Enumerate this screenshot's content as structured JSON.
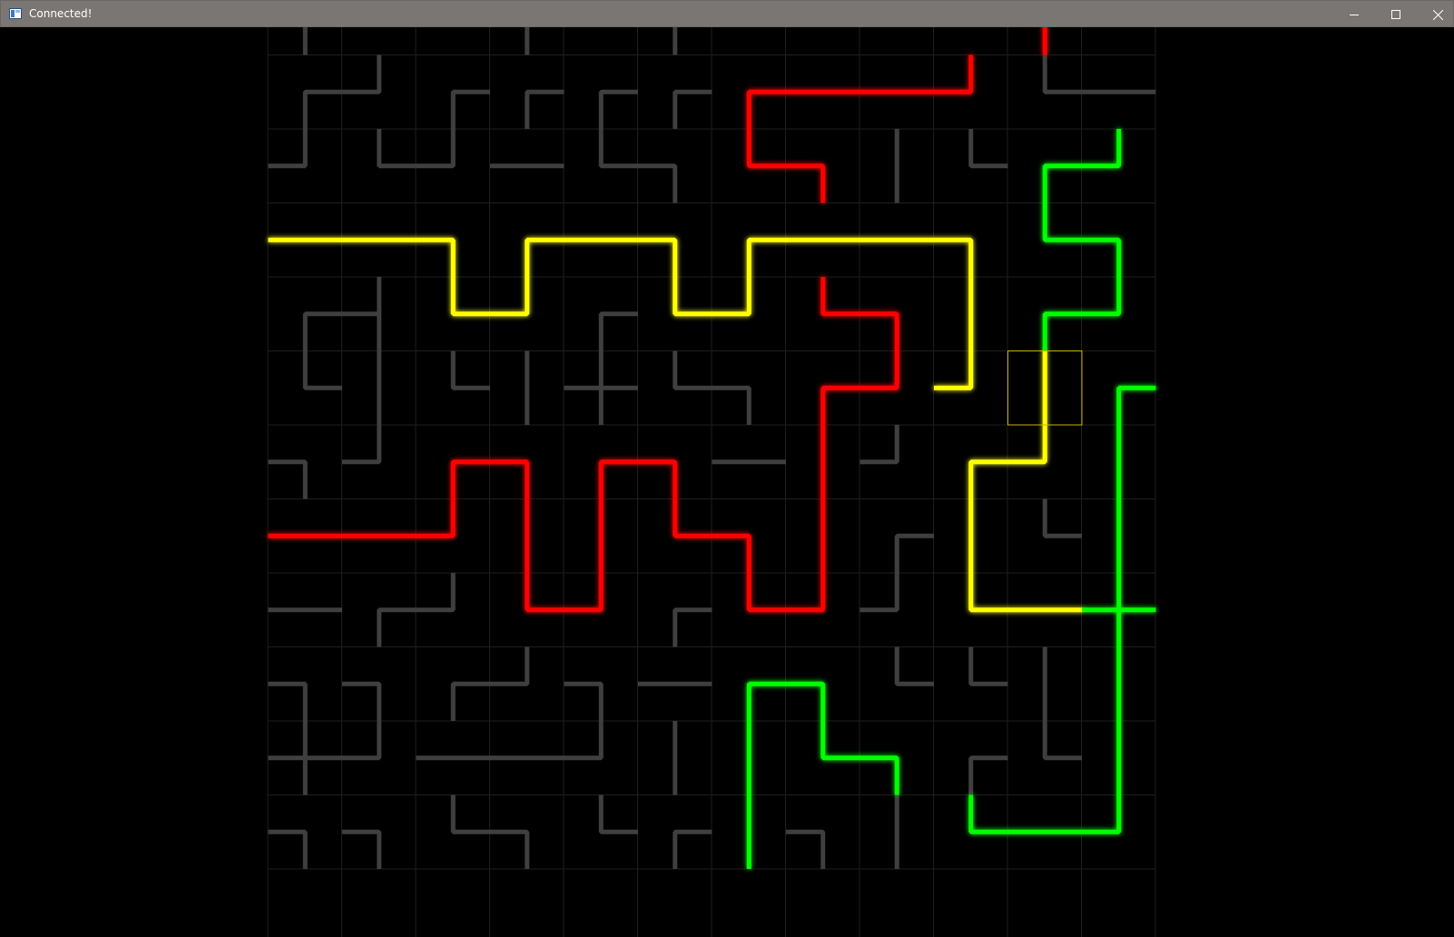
{
  "window": {
    "title": "Connected!",
    "controls": {
      "minimize": "minimize-icon",
      "maximize": "maximize-icon",
      "close": "close-icon"
    }
  },
  "game": {
    "cols": 12,
    "rows": 12,
    "colors": {
      "background": "#000000",
      "grid": "#1e1e1e",
      "inactive": "#3f3f3f",
      "red": "#ff0000",
      "yellow": "#ffff00",
      "green": "#00ff00",
      "cursor": "#c8b400"
    },
    "cursor": {
      "col": 10,
      "row": 5
    },
    "tiles": [
      [
        "gray",
        "e",
        "nse"
      ],
      [
        "gray",
        "w",
        "nw"
      ],
      [
        "gray",
        "e",
        "n"
      ],
      [
        "gray",
        "e",
        "es"
      ],
      [
        "gray",
        "e",
        "ew"
      ],
      [
        "gray",
        "e",
        "esw"
      ],
      [
        "gray",
        "e",
        "ew"
      ],
      [
        "gray",
        "e",
        "ew"
      ],
      [
        "gray",
        "e",
        "w"
      ],
      [
        "gray",
        "e",
        "en"
      ],
      [
        "red",
        "e",
        "es"
      ],
      [
        "red",
        "e",
        "ew"
      ],
      [
        "gray",
        "e",
        "es"
      ],
      [
        "gray",
        "e",
        "nw"
      ],
      [
        "gray",
        "e",
        "es"
      ],
      [
        "gray",
        "e",
        "es"
      ],
      [
        "gray",
        "e",
        "es"
      ],
      [
        "gray",
        "e",
        "es"
      ],
      [
        "red",
        "e",
        "es"
      ],
      [
        "red",
        "e",
        "ew"
      ],
      [
        "red",
        "e",
        "ew"
      ],
      [
        "red",
        "e",
        "nw"
      ],
      [
        "gray",
        "e",
        "ne"
      ],
      [
        "gray",
        "e",
        "ew"
      ],
      [
        "gray",
        "e",
        "nw"
      ],
      [
        "gray",
        "e",
        "ne"
      ],
      [
        "gray",
        "e",
        "nw"
      ],
      [
        "gray",
        "e",
        "ew"
      ],
      [
        "gray",
        "e",
        "ne"
      ],
      [
        "gray",
        "e",
        "sw"
      ],
      [
        "red",
        "e",
        "ne"
      ],
      [
        "red",
        "e",
        "sw"
      ],
      [
        "gray",
        "e",
        "ns"
      ],
      [
        "gray",
        "e",
        "ne"
      ],
      [
        "green",
        "e",
        "es"
      ],
      [
        "green",
        "e",
        "nw"
      ],
      [
        "yellow",
        "e",
        "ew"
      ],
      [
        "yellow",
        "e",
        "ew"
      ],
      [
        "yellow",
        "e",
        "sw"
      ],
      [
        "yellow",
        "e",
        "es"
      ],
      [
        "yellow",
        "e",
        "ew"
      ],
      [
        "yellow",
        "e",
        "sw"
      ],
      [
        "yellow",
        "e",
        "es"
      ],
      [
        "yellow",
        "e",
        "ew"
      ],
      [
        "yellow",
        "e",
        "ew"
      ],
      [
        "yellow",
        "e",
        "sw"
      ],
      [
        "green",
        "e",
        "ne"
      ],
      [
        "green",
        "e",
        "sw"
      ],
      [
        "gray",
        "e",
        "es"
      ],
      [
        "gray",
        "e",
        "nsw"
      ],
      [
        "yellow",
        "e",
        "ne"
      ],
      [
        "yellow",
        "e",
        "nw"
      ],
      [
        "gray",
        "e",
        "es"
      ],
      [
        "yellow",
        "e",
        "ne"
      ],
      [
        "yellow",
        "e",
        "nw"
      ],
      [
        "red",
        "e",
        "ne"
      ],
      [
        "red",
        "e",
        "sw"
      ],
      [
        "yellow",
        "e",
        "ns"
      ],
      [
        "green",
        "e",
        "es"
      ],
      [
        "green",
        "e",
        "nw"
      ],
      [
        "gray",
        "e",
        "ne"
      ],
      [
        "gray",
        "e",
        "ns"
      ],
      [
        "gray",
        "e",
        "ne"
      ],
      [
        "gray",
        "e",
        "ns"
      ],
      [
        "gray",
        "e",
        "nsew"
      ],
      [
        "gray",
        "e",
        "ne"
      ],
      [
        "gray",
        "e",
        "sw"
      ],
      [
        "red",
        "e",
        "es"
      ],
      [
        "red",
        "e",
        "nw"
      ],
      [
        "yellow",
        "e",
        "nw"
      ],
      [
        "yellow",
        "e",
        "ns"
      ],
      [
        "green",
        "e",
        "es"
      ],
      [
        "gray",
        "e",
        "sw"
      ],
      [
        "gray",
        "e",
        "nw"
      ],
      [
        "red",
        "e",
        "es"
      ],
      [
        "red",
        "e",
        "sw"
      ],
      [
        "red",
        "e",
        "es"
      ],
      [
        "red",
        "e",
        "sw"
      ],
      [
        "gray",
        "e",
        "ew"
      ],
      [
        "red",
        "e",
        "ns"
      ],
      [
        "gray",
        "e",
        "nw"
      ],
      [
        "yellow",
        "e",
        "es"
      ],
      [
        "yellow",
        "e",
        "nw"
      ],
      [
        "green",
        "e",
        "ns"
      ],
      [
        "red",
        "e",
        "ew"
      ],
      [
        "red",
        "e",
        "ew"
      ],
      [
        "red",
        "e",
        "nw"
      ],
      [
        "red",
        "e",
        "ns"
      ],
      [
        "red",
        "e",
        "ns"
      ],
      [
        "red",
        "e",
        "ne"
      ],
      [
        "red",
        "e",
        "sw"
      ],
      [
        "red",
        "e",
        "ns"
      ],
      [
        "gray",
        "e",
        "es"
      ],
      [
        "yellow",
        "e",
        "ns"
      ],
      [
        "gray",
        "e",
        "ne"
      ],
      [
        "green",
        "e",
        "ns"
      ],
      [
        "gray",
        "e",
        "ew"
      ],
      [
        "gray",
        "e",
        "es"
      ],
      [
        "gray",
        "e",
        "nw"
      ],
      [
        "red",
        "e",
        "ne"
      ],
      [
        "red",
        "e",
        "nw"
      ],
      [
        "gray",
        "e",
        "es"
      ],
      [
        "red",
        "e",
        "ne"
      ],
      [
        "red",
        "e",
        "nw"
      ],
      [
        "gray",
        "e",
        "nw"
      ],
      [
        "yellow",
        "e",
        "ne"
      ],
      [
        "yellow",
        "e",
        "ew"
      ],
      [
        "green",
        "e",
        "nsew"
      ],
      [
        "gray",
        "e",
        "sw"
      ],
      [
        "gray",
        "e",
        "sw"
      ],
      [
        "gray",
        "e",
        "es"
      ],
      [
        "gray",
        "e",
        "nw"
      ],
      [
        "gray",
        "e",
        "sw"
      ],
      [
        "gray",
        "e",
        "ew"
      ],
      [
        "green",
        "e",
        "es"
      ],
      [
        "green",
        "e",
        "sw"
      ],
      [
        "gray",
        "e",
        "ne"
      ],
      [
        "gray",
        "e",
        "ne"
      ],
      [
        "gray",
        "e",
        "ns"
      ],
      [
        "green",
        "e",
        "ns"
      ],
      [
        "gray",
        "e",
        "nsew"
      ],
      [
        "gray",
        "e",
        "nw"
      ],
      [
        "gray",
        "e",
        "ew"
      ],
      [
        "gray",
        "e",
        "ew"
      ],
      [
        "gray",
        "e",
        "nw"
      ],
      [
        "gray",
        "e",
        "ns"
      ],
      [
        "green",
        "e",
        "ns"
      ],
      [
        "green",
        "e",
        "ne"
      ],
      [
        "green",
        "e",
        "sw"
      ],
      [
        "gray",
        "e",
        "es"
      ],
      [
        "gray",
        "e",
        "ne"
      ],
      [
        "green",
        "e",
        "ns"
      ],
      [
        "gray",
        "e",
        "sw"
      ],
      [
        "gray",
        "e",
        "sw"
      ],
      [
        "gray",
        "e",
        "ne"
      ],
      [
        "gray",
        "e",
        "sw"
      ],
      [
        "gray",
        "e",
        "ne"
      ],
      [
        "gray",
        "e",
        "es"
      ],
      [
        "green",
        "e",
        "ns"
      ],
      [
        "gray",
        "e",
        "sw"
      ],
      [
        "gray",
        "e",
        "ns"
      ],
      [
        "green",
        "e",
        "ne"
      ],
      [
        "green",
        "e",
        "ew"
      ],
      [
        "green",
        "e",
        "nw"
      ]
    ]
  }
}
